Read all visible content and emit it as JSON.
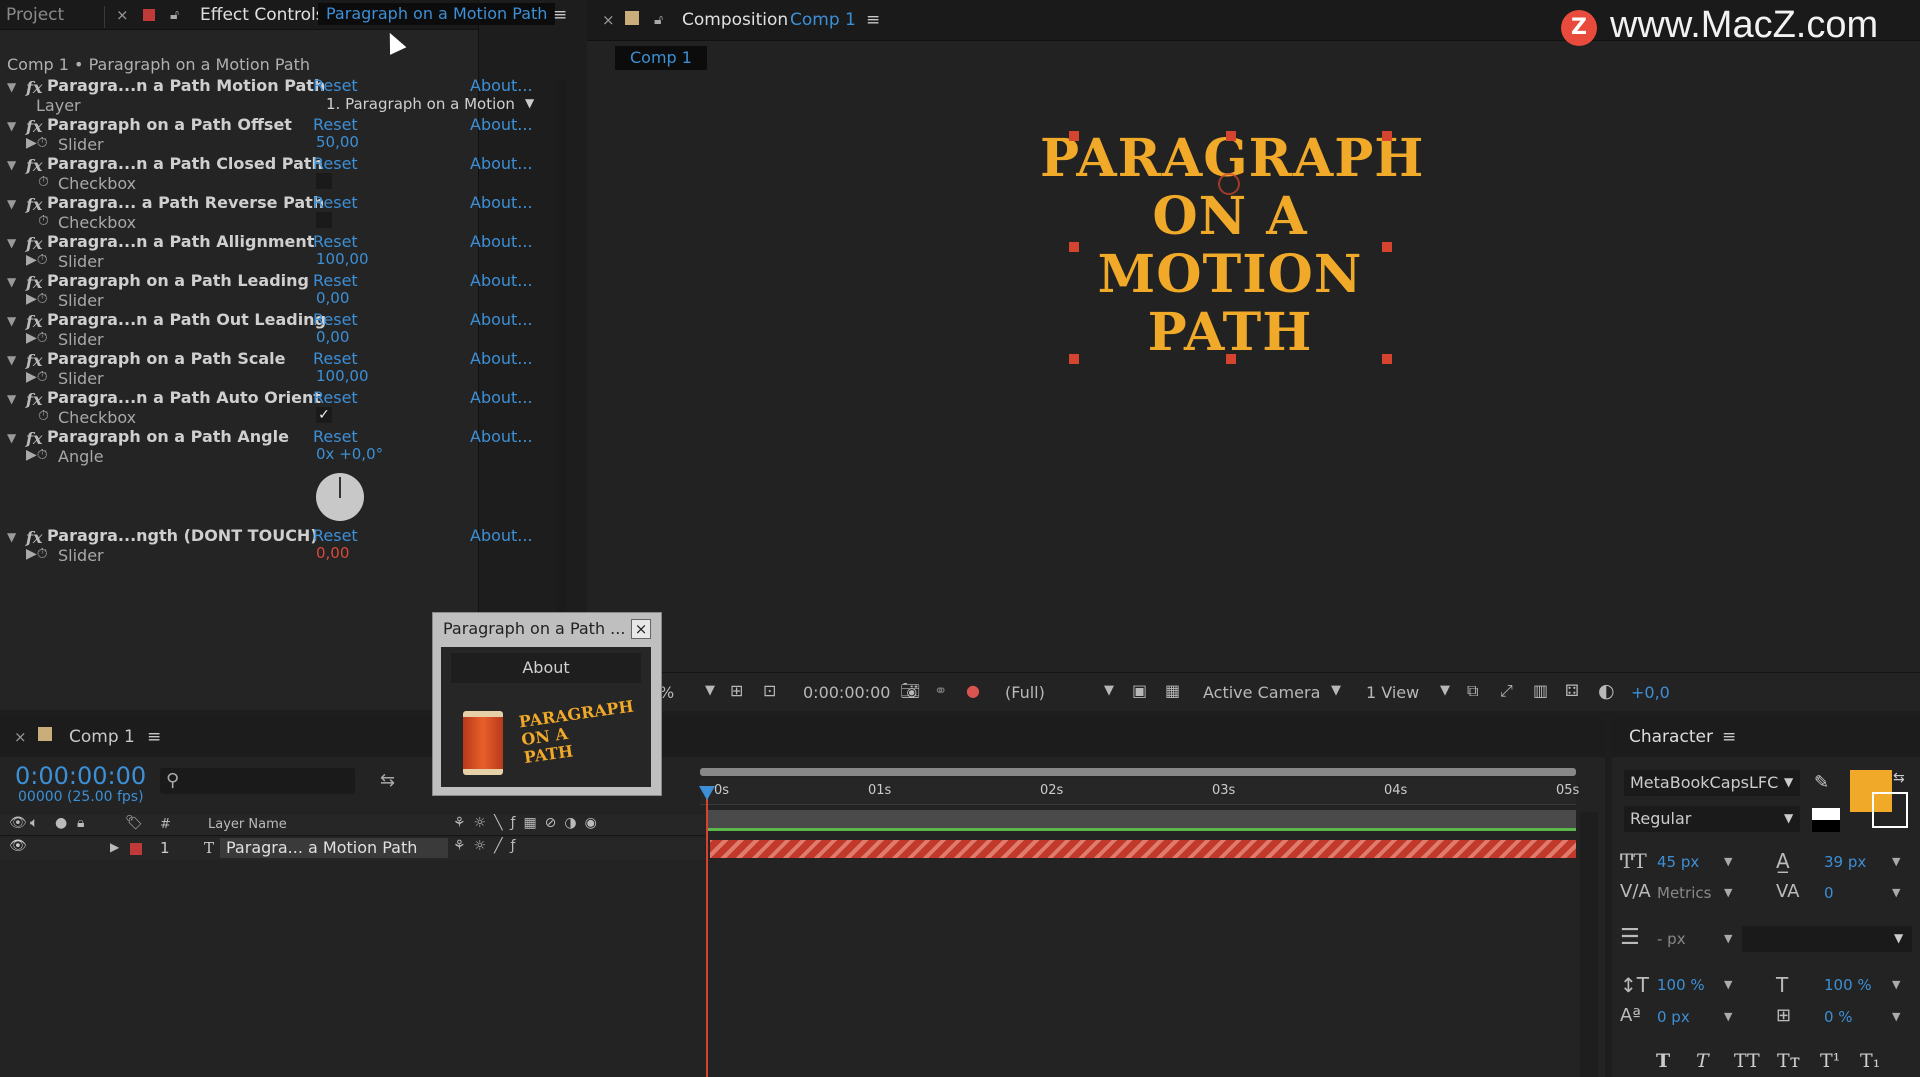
{
  "watermark": "www.MacZ.com",
  "effect_panel": {
    "tab_project": "Project",
    "tab_effect": "Effect Controls",
    "tab_effect_target": "Paragraph on a Motion Path",
    "breadcrumb": "Comp 1 • Paragraph on a Motion Path",
    "reset": "Reset",
    "about": "About...",
    "effects": [
      {
        "name": "Paragra...n a Path Motion Path",
        "param": "Layer",
        "value": "1. Paragraph on a Motion"
      },
      {
        "name": "Paragraph on a Path Offset",
        "param": "Slider",
        "value": "50,00"
      },
      {
        "name": "Paragra...n a Path Closed Path",
        "param": "Checkbox",
        "value": ""
      },
      {
        "name": "Paragra... a Path Reverse Path",
        "param": "Checkbox",
        "value": ""
      },
      {
        "name": "Paragra...n a Path Allignment",
        "param": "Slider",
        "value": "100,00"
      },
      {
        "name": "Paragraph on a Path Leading",
        "param": "Slider",
        "value": "0,00"
      },
      {
        "name": "Paragra...n a Path Out Leading",
        "param": "Slider",
        "value": "0,00"
      },
      {
        "name": "Paragraph on a Path Scale",
        "param": "Slider",
        "value": "100,00"
      },
      {
        "name": "Paragra...n a Path Auto Orient",
        "param": "Checkbox",
        "value": "✓"
      },
      {
        "name": "Paragraph on a Path Angle",
        "param": "Angle",
        "value": "0x +0,0°"
      },
      {
        "name": "Paragra...ngth (DONT TOUCH)",
        "param": "Slider",
        "value": "0,00"
      }
    ]
  },
  "composition": {
    "tab_label": "Composition",
    "tab_target": "Comp 1",
    "subtab": "Comp 1",
    "title_lines": [
      "PARAGRAPH",
      "ON A",
      "MOTION",
      "PATH"
    ],
    "toolbar": {
      "zoom_suffix": "%",
      "timecode": "0:00:00:00",
      "resolution": "(Full)",
      "camera": "Active Camera",
      "views": "1 View",
      "exposure": "+0,0"
    }
  },
  "about_popup": {
    "title": "Paragraph on a Path ...",
    "close": "×",
    "heading": "About",
    "logo_text": [
      "PARAGRAPH",
      "ON A",
      "PATH"
    ]
  },
  "timeline": {
    "tab": "Comp 1",
    "timecode": "0:00:00:00",
    "frames": "00000 (25.00 fps)",
    "col_number": "#",
    "col_layer": "Layer Name",
    "layer_index": "1",
    "layer_name": "Paragra... a Motion Path",
    "ruler": [
      "0s",
      "01s",
      "02s",
      "03s",
      "04s",
      "05s"
    ]
  },
  "character": {
    "tab": "Character",
    "font": "MetaBookCapsLFC",
    "style": "Regular",
    "size": "45 px",
    "leading": "39 px",
    "kerning": "Metrics",
    "tracking": "0",
    "stroke": "- px",
    "vscale": "100 %",
    "hscale": "100 %",
    "baseline": "0 px",
    "tsume": "0 %",
    "fill_color": "#f0a929",
    "styles": [
      "T",
      "T",
      "TT",
      "Tт",
      "T¹",
      "T₁"
    ]
  }
}
